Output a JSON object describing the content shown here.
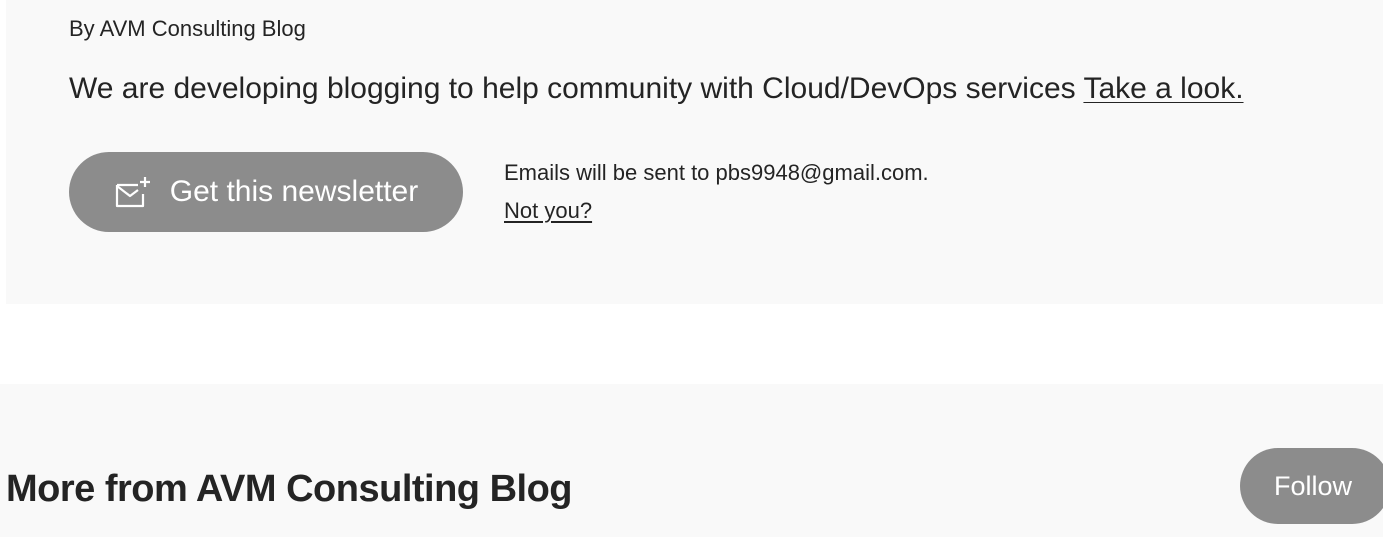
{
  "newsletter": {
    "byline": "By AVM Consulting Blog",
    "description": "We are developing blogging to help community with Cloud/DevOps services",
    "description_link": "Take a look.",
    "subscribe_button_label": "Get this newsletter",
    "subscribe_icon": "mail-plus-icon",
    "email_note": "Emails will be sent to pbs9948@gmail.com.",
    "not_you_link": "Not you?"
  },
  "more_from": {
    "title": "More from AVM Consulting Blog",
    "follow_button_label": "Follow"
  },
  "colors": {
    "button_bg": "#8c8c8c",
    "card_bg": "#f9f9f9",
    "text": "#242424"
  }
}
